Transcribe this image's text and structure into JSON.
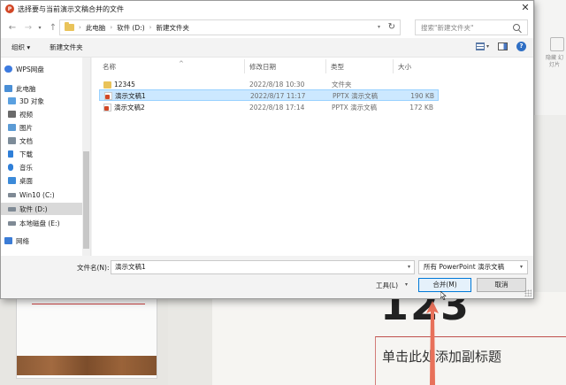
{
  "dialog": {
    "title": "选择要与当前演示文稿合并的文件",
    "close_glyph": "✕"
  },
  "nav": {
    "back": "←",
    "forward": "→",
    "dropdown": "▾",
    "up": "↑",
    "breadcrumb": [
      "此电脑",
      "软件 (D:)",
      "新建文件夹"
    ],
    "breadcrumb_sep": "›",
    "refresh": "↻",
    "search_placeholder": "搜索\"新建文件夹\""
  },
  "toolbar": {
    "organize": "组织 ▾",
    "new_folder": "新建文件夹"
  },
  "sidebar": {
    "items": [
      {
        "label": "WPS网盘",
        "icon": "cloud-icon",
        "color": "#3d7be0"
      },
      {
        "label": "此电脑",
        "icon": "computer-icon",
        "color": "#4a8fd6"
      },
      {
        "label": "3D 对象",
        "icon": "3d-objects-icon",
        "color": "#5aa0e0"
      },
      {
        "label": "视频",
        "icon": "video-icon",
        "color": "#6a6a6a"
      },
      {
        "label": "图片",
        "icon": "pictures-icon",
        "color": "#5b9bd5"
      },
      {
        "label": "文档",
        "icon": "documents-icon",
        "color": "#7d8c99"
      },
      {
        "label": "下载",
        "icon": "download-icon",
        "color": "#2f7fd8"
      },
      {
        "label": "音乐",
        "icon": "music-icon",
        "color": "#2f7fd8"
      },
      {
        "label": "桌面",
        "icon": "desktop-icon",
        "color": "#3b8ad9"
      },
      {
        "label": "Win10 (C:)",
        "icon": "drive-icon",
        "color": "#7f8a95"
      },
      {
        "label": "软件 (D:)",
        "icon": "drive-icon",
        "color": "#7f8a95"
      },
      {
        "label": "本地磁盘 (E:)",
        "icon": "drive-icon",
        "color": "#7f8a95"
      },
      {
        "label": "网络",
        "icon": "network-icon",
        "color": "#3b7cd6"
      }
    ]
  },
  "files": {
    "columns": {
      "name": "名称",
      "date": "修改日期",
      "type": "类型",
      "size": "大小"
    },
    "sort_caret": "^",
    "rows": [
      {
        "name": "12345",
        "date": "2022/8/18 10:30",
        "type": "文件夹",
        "size": "",
        "kind": "folder"
      },
      {
        "name": "演示文稿1",
        "date": "2022/8/17 11:17",
        "type": "PPTX 演示文稿",
        "size": "190 KB",
        "kind": "ppt"
      },
      {
        "name": "演示文稿2",
        "date": "2022/8/18 17:14",
        "type": "PPTX 演示文稿",
        "size": "172 KB",
        "kind": "ppt"
      }
    ],
    "selected_index": 1
  },
  "bottom": {
    "filename_label": "文件名(N):",
    "filename_value": "演示文稿1",
    "filetype_value": "所有 PowerPoint 演示文稿",
    "tools_label": "工具(L)",
    "merge_label": "合并(M)",
    "cancel_label": "取消"
  },
  "background": {
    "ribbon_text": "隐藏 幻灯片",
    "slide_number": "123",
    "subtitle_placeholder": "单击此处添加副标题",
    "accent_color": "#c0504d",
    "arrow_color": "#e8715a"
  }
}
